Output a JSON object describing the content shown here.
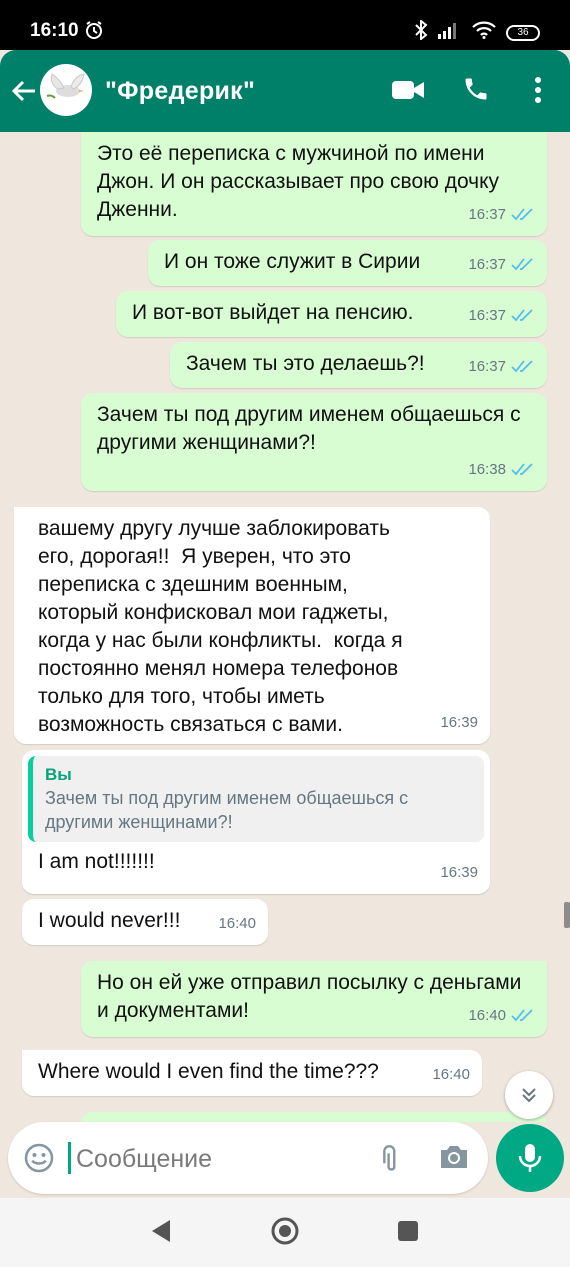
{
  "status_bar": {
    "time": "16:10",
    "battery": "36"
  },
  "header": {
    "contact_name": "\"Фредерик\""
  },
  "messages": [
    {
      "direction": "out",
      "text": "Это её переписка с мужчиной по имени Джон. И он рассказывает про свою дочку Дженни.",
      "time": "16:37",
      "status": "read"
    },
    {
      "direction": "out",
      "text": "И он тоже служит в Сирии",
      "time": "16:37",
      "status": "read"
    },
    {
      "direction": "out",
      "text": "И вот-вот выйдет на пенсию.",
      "time": "16:37",
      "status": "read"
    },
    {
      "direction": "out",
      "text": "Зачем ты это делаешь?!",
      "time": "16:37",
      "status": "read"
    },
    {
      "direction": "out",
      "text": "Зачем ты под другим именем общаешься с другими женщинами?!",
      "time": "16:38",
      "status": "read"
    },
    {
      "direction": "in",
      "text": "вашему другу лучше заблокировать его, дорогая!!  Я уверен, что это переписка с здешним военным, который конфисковал мои гаджеты, когда у нас были конфликты.  когда я постоянно менял номера телефонов только для того, чтобы иметь возможность связаться с вами.",
      "time": "16:39"
    },
    {
      "direction": "in",
      "quote_author": "Вы",
      "quote_text": "Зачем ты под другим именем общаешься с другими женщинами?!",
      "text": "I am not!!!!!!!",
      "time": "16:39"
    },
    {
      "direction": "in",
      "text": "I would never!!!",
      "time": "16:40"
    },
    {
      "direction": "out",
      "text": "Но он ей уже отправил посылку с деньгами и документами!",
      "time": "16:40",
      "status": "read"
    },
    {
      "direction": "in",
      "text": "Where would I even find the time???",
      "time": "16:40"
    }
  ],
  "composer": {
    "placeholder": "Сообщение"
  },
  "colors": {
    "header": "#008069",
    "outgoing": "#d9fdd3",
    "incoming": "#ffffff",
    "accent": "#00a884",
    "read_ticks": "#53bdeb",
    "background": "#efe7dd"
  },
  "icons": [
    "back-arrow-icon",
    "dove-avatar",
    "video-call-icon",
    "phone-icon",
    "more-vert-icon",
    "double-check-icon",
    "scroll-down-icon",
    "emoji-icon",
    "attach-icon",
    "camera-icon",
    "mic-icon",
    "nav-back-icon",
    "nav-home-icon",
    "nav-recents-icon"
  ]
}
